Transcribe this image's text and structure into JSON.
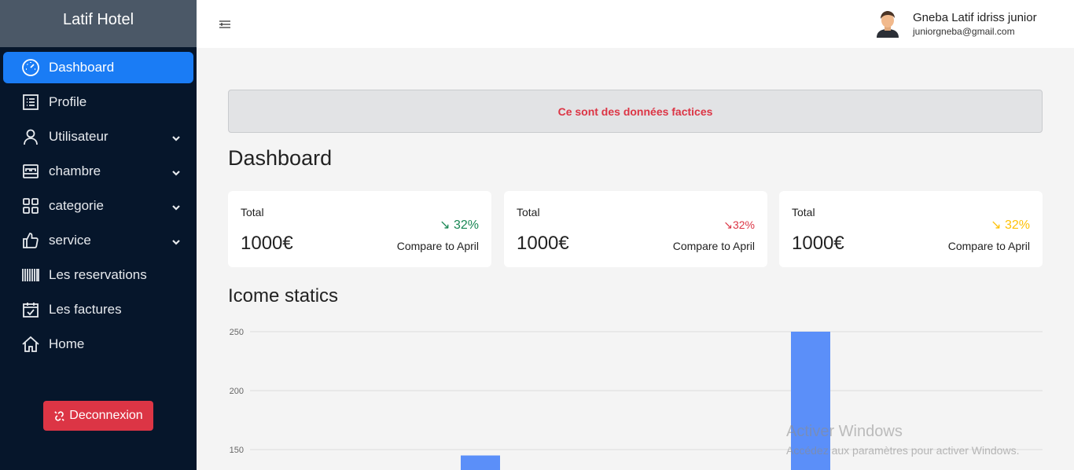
{
  "brand": "Latif Hotel",
  "sidebar": {
    "items": [
      {
        "label": "Dashboard",
        "icon": "dashboard-icon"
      },
      {
        "label": "Profile",
        "icon": "list-icon"
      },
      {
        "label": "Utilisateur",
        "icon": "user-icon",
        "expandable": true
      },
      {
        "label": "chambre",
        "icon": "bed-icon",
        "expandable": true
      },
      {
        "label": "categorie",
        "icon": "grid-icon",
        "expandable": true
      },
      {
        "label": "service",
        "icon": "thumbs-up-icon",
        "expandable": true
      },
      {
        "label": "Les reservations",
        "icon": "barcode-icon"
      },
      {
        "label": "Les factures",
        "icon": "calendar-check-icon"
      },
      {
        "label": "Home",
        "icon": "house-icon"
      }
    ],
    "active_index": 0,
    "logout_label": "Deconnexion"
  },
  "header": {
    "user_name": "Gneba Latif idriss junior",
    "user_email": "juniorgneba@gmail.com"
  },
  "alert": "Ce sont des données factices",
  "page_title": "Dashboard",
  "cards": [
    {
      "label": "Total",
      "value": "1000€",
      "trend": "32%",
      "trend_color": "#198754",
      "compare": "Compare to April"
    },
    {
      "label": "Total",
      "value": "1000€",
      "trend": "32%",
      "trend_color": "#dc3545",
      "compare": "Compare to April"
    },
    {
      "label": "Total",
      "value": "1000€",
      "trend": "32%",
      "trend_color": "#ffc107",
      "compare": "Compare to April"
    }
  ],
  "section_title": "Icome statics",
  "chart_data": {
    "type": "bar",
    "y_ticks": [
      250,
      200,
      150
    ],
    "ylim": [
      130,
      260
    ],
    "bars": [
      {
        "value": 145
      },
      {
        "value": 250
      }
    ],
    "bar_color": "#5b8ff9",
    "grid": true
  },
  "watermark": {
    "line1": "Activer Windows",
    "line2": "Accédez aux paramètres pour activer Windows."
  }
}
